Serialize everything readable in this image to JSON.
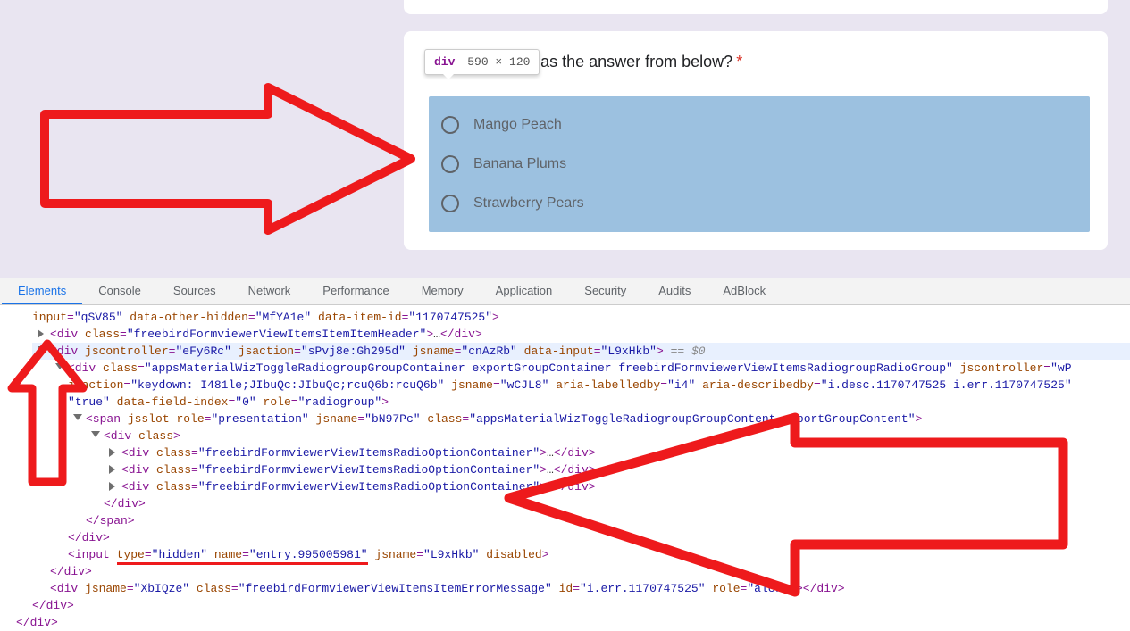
{
  "tooltip": {
    "tag": "div",
    "dims": "590 × 120"
  },
  "question": {
    "text": "ould you prefer as the answer from below?",
    "asterisk": "*"
  },
  "options": [
    {
      "label": "Mango Peach"
    },
    {
      "label": "Banana Plums"
    },
    {
      "label": "Strawberry Pears"
    }
  ],
  "tabs": [
    {
      "label": "Elements",
      "active": true
    },
    {
      "label": "Console",
      "active": false
    },
    {
      "label": "Sources",
      "active": false
    },
    {
      "label": "Network",
      "active": false
    },
    {
      "label": "Performance",
      "active": false
    },
    {
      "label": "Memory",
      "active": false
    },
    {
      "label": "Application",
      "active": false
    },
    {
      "label": "Security",
      "active": false
    },
    {
      "label": "Audits",
      "active": false
    },
    {
      "label": "AdBlock",
      "active": false
    }
  ],
  "dom": {
    "l0_input": "input",
    "l0_a1n": "qSV85",
    "l0_a2n": "MfYA1e",
    "l0_a3n": "1170747525",
    "l1_cls": "freebirdFormviewerViewItemsItemItemHeader",
    "l2_jc": "eFy6Rc",
    "l2_ja": "sPvj8e:Gh295d",
    "l2_jn": "cnAzRb",
    "l2_di": "L9xHkb",
    "l2_eq": "== $0",
    "l3_cls": "appsMaterialWizToggleRadiogroupGroupContainer exportGroupContainer freebirdFormviewerViewItemsRadiogroupRadioGroup",
    "l3_jc": "wP",
    "l3b_ja": "keydown: I481le;JIbuQc:JIbuQc;rcuQ6b:rcuQ6b",
    "l3b_jn": "wCJL8",
    "l3b_alb": "i4",
    "l3b_adb": "i.desc.1170747525 i.err.1170747525",
    "l3c_true": "true",
    "l3c_dfi": "0",
    "l3c_role": "radiogroup",
    "l4_role": "presentation",
    "l4_jn": "bN97Pc",
    "l4_cls": "appsMaterialWizToggleRadiogroupGroupContent exportGroupContent",
    "l5_class_label": "class",
    "l6_cls": "freebirdFormviewerViewItemsRadioOptionContainer",
    "l8_type": "hidden",
    "l8_name": "entry.995005981",
    "l8_jn": "L9xHkb",
    "l8_dis": "disabled",
    "l9_jn": "XbIQze",
    "l9_cls": "freebirdFormviewerViewItemsItemErrorMessage",
    "l9_id": "i.err.1170747525",
    "l9_role": "alert"
  }
}
